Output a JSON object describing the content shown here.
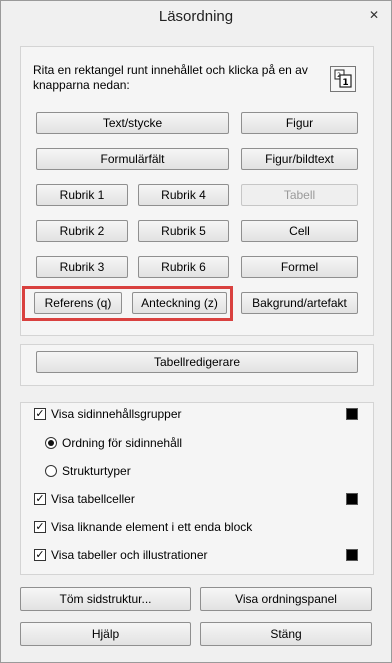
{
  "window": {
    "title": "Läsordning",
    "close_glyph": "✕"
  },
  "tag_panel": {
    "instruction": "Rita en rektangel runt innehållet och klicka på en av knapparna nedan:",
    "buttons": {
      "text": "Text/stycke",
      "figure": "Figur",
      "form_field": "Formulärfält",
      "figure_caption": "Figur/bildtext",
      "heading1": "Rubrik 1",
      "heading4": "Rubrik 4",
      "table": "Tabell",
      "heading2": "Rubrik 2",
      "heading5": "Rubrik 5",
      "cell": "Cell",
      "heading3": "Rubrik 3",
      "heading6": "Rubrik 6",
      "formula": "Formel",
      "reference": "Referens (q)",
      "note": "Anteckning (z)",
      "background": "Bakgrund/artefakt"
    }
  },
  "table_editor": {
    "label": "Tabellredigerare"
  },
  "options": {
    "show_content_groups": "Visa sidinnehållsgrupper",
    "order_radio": "Ordning för sidinnehåll",
    "structure_radio": "Strukturtyper",
    "show_table_cells": "Visa tabellceller",
    "show_similar": "Visa liknande element i ett enda block",
    "show_tables_figures": "Visa tabeller och illustrationer",
    "colors": {
      "swatch": "#000000",
      "highlight": "#d9413f"
    }
  },
  "footer": {
    "clear_structure": "Töm sidstruktur...",
    "show_order_panel": "Visa ordningspanel",
    "help": "Hjälp",
    "close": "Stäng"
  }
}
